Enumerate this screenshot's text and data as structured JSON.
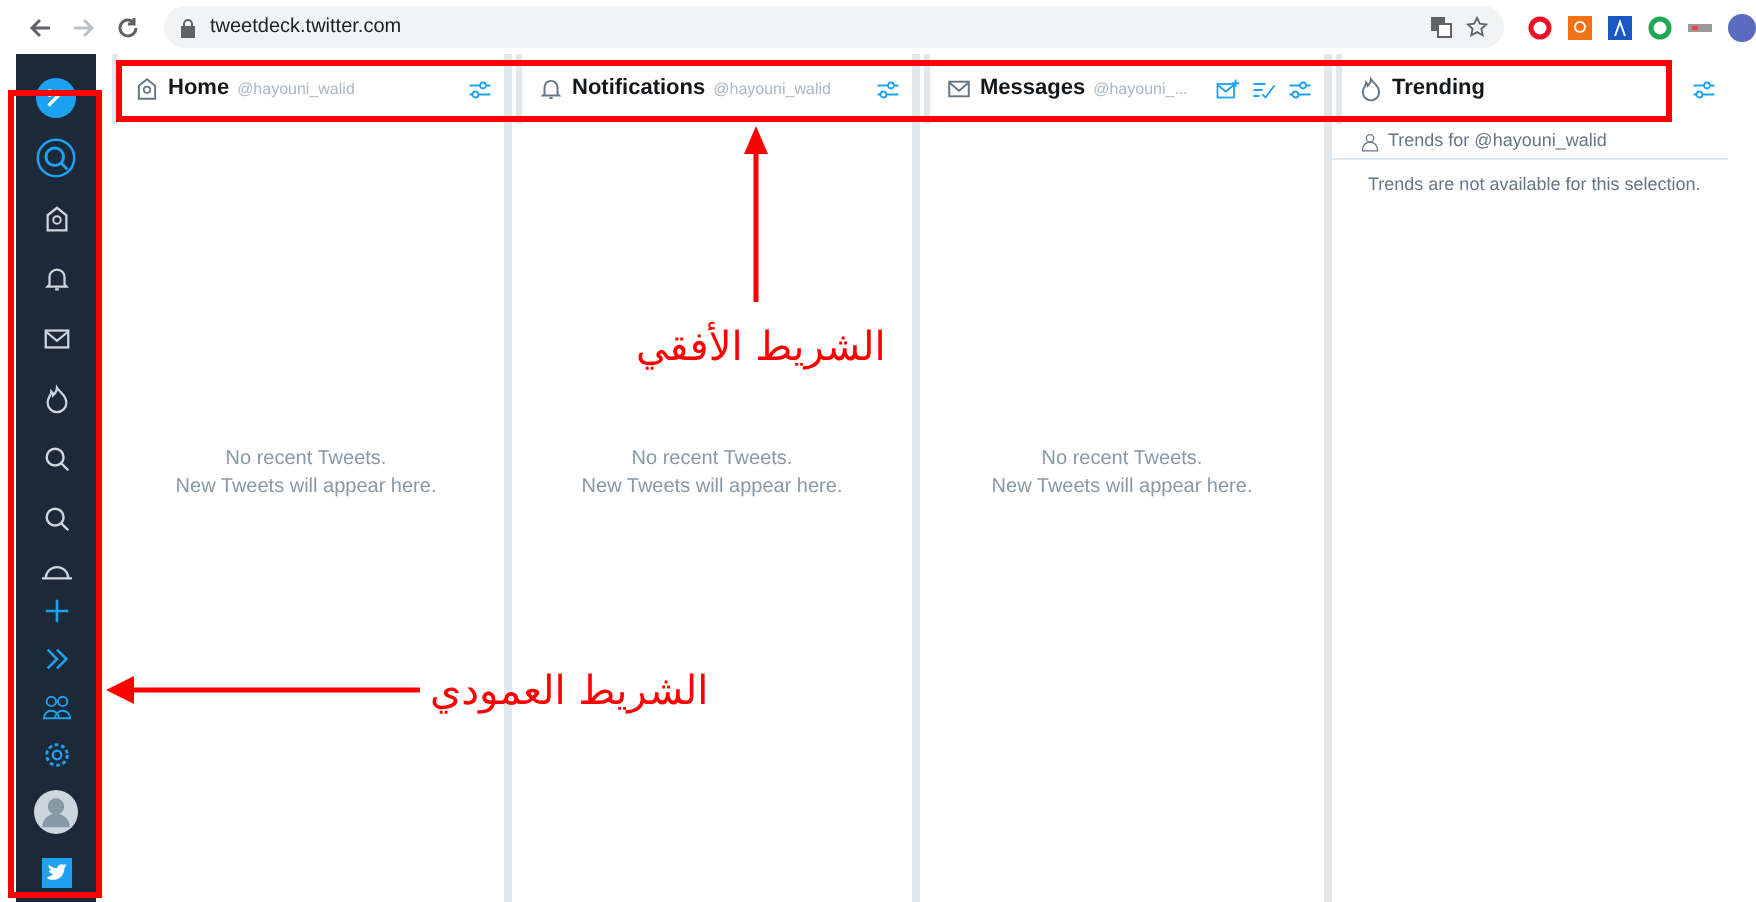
{
  "browser": {
    "url": "tweetdeck.twitter.com"
  },
  "columns": [
    {
      "kind": "timeline",
      "title": "Home",
      "account": "@hayouni_walid",
      "empty_lines": [
        "No recent Tweets.",
        "New Tweets will appear here."
      ]
    },
    {
      "kind": "timeline",
      "title": "Notifications",
      "account": "@hayouni_walid",
      "empty_lines": [
        "No recent Tweets.",
        "New Tweets will appear here."
      ]
    },
    {
      "kind": "timeline",
      "title": "Messages",
      "account": "@hayouni_...",
      "empty_lines": [
        "No recent Tweets.",
        "New Tweets will appear here."
      ]
    },
    {
      "kind": "trending",
      "title": "Trending",
      "trends_for": "Trends for @hayouni_walid",
      "message": "Trends are not available for this selection."
    }
  ],
  "annotations": [
    {
      "kind": "horizontal",
      "text": "الشريط الأفقي"
    },
    {
      "kind": "vertical",
      "text": "الشريط العمودي"
    }
  ]
}
